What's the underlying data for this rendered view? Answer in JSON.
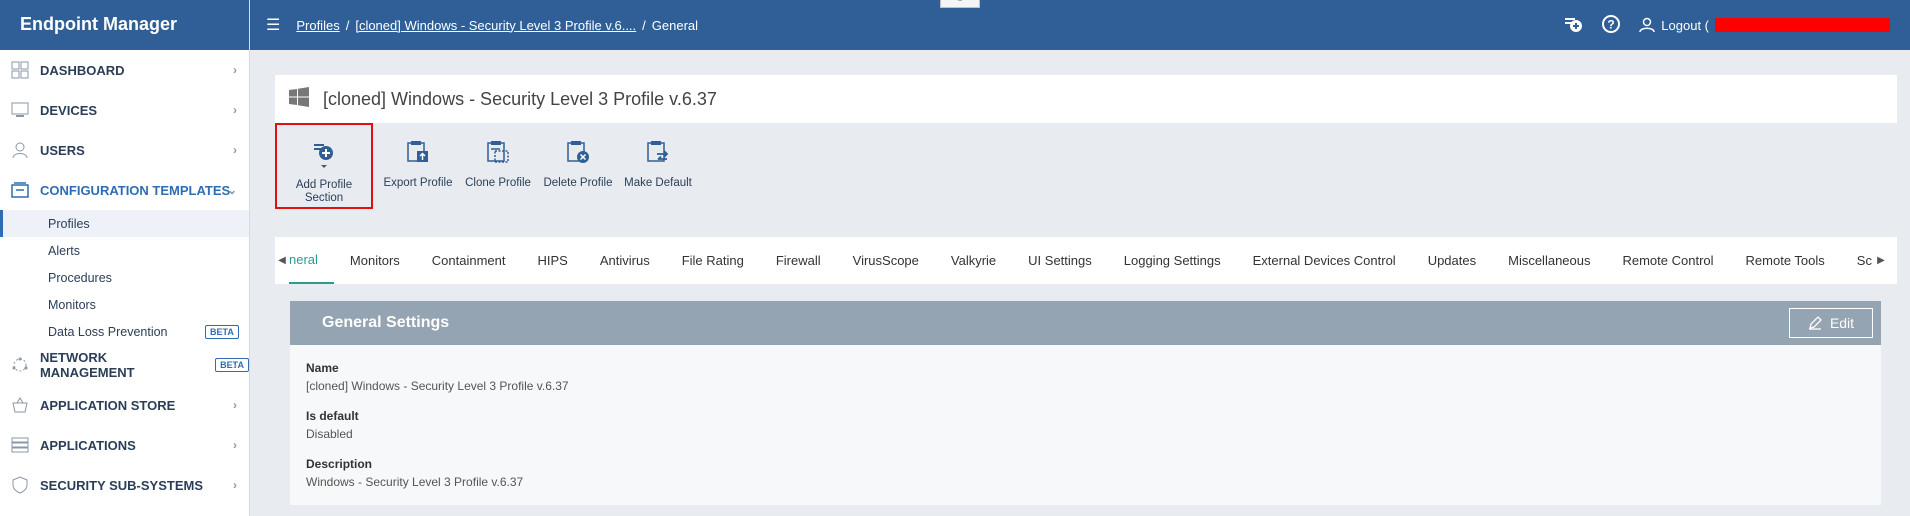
{
  "app": {
    "title": "Endpoint Manager"
  },
  "breadcrumb": {
    "items": [
      "Profiles",
      "[cloned] Windows - Security Level 3 Profile v.6....",
      "General"
    ]
  },
  "topbar": {
    "logout_label": "Logout ("
  },
  "sidebar": {
    "items": [
      {
        "label": "DASHBOARD",
        "icon": "dashboard-icon"
      },
      {
        "label": "DEVICES",
        "icon": "devices-icon"
      },
      {
        "label": "USERS",
        "icon": "user-icon"
      },
      {
        "label": "CONFIGURATION TEMPLATES",
        "icon": "templates-icon",
        "expanded": true
      },
      {
        "label": "NETWORK MANAGEMENT",
        "icon": "network-icon",
        "badge": "BETA"
      },
      {
        "label": "APPLICATION STORE",
        "icon": "store-icon"
      },
      {
        "label": "APPLICATIONS",
        "icon": "applications-icon"
      },
      {
        "label": "SECURITY SUB-SYSTEMS",
        "icon": "shield-icon"
      }
    ],
    "sub_items": [
      {
        "label": "Profiles",
        "selected": true
      },
      {
        "label": "Alerts"
      },
      {
        "label": "Procedures"
      },
      {
        "label": "Monitors"
      },
      {
        "label": "Data Loss Prevention",
        "badge": "BETA"
      }
    ]
  },
  "profile": {
    "title": "[cloned] Windows - Security Level 3 Profile v.6.37"
  },
  "toolbar": {
    "add_section": "Add Profile Section",
    "export": "Export Profile",
    "clone": "Clone Profile",
    "delete": "Delete Profile",
    "make_default": "Make Default"
  },
  "tabs": [
    "neral",
    "Monitors",
    "Containment",
    "HIPS",
    "Antivirus",
    "File Rating",
    "Firewall",
    "VirusScope",
    "Valkyrie",
    "UI Settings",
    "Logging Settings",
    "External Devices Control",
    "Updates",
    "Miscellaneous",
    "Remote Control",
    "Remote Tools",
    "Sc"
  ],
  "panel": {
    "title": "General Settings",
    "edit_label": "Edit",
    "fields": [
      {
        "label": "Name",
        "value": "[cloned] Windows - Security Level 3 Profile v.6.37"
      },
      {
        "label": "Is default",
        "value": "Disabled"
      },
      {
        "label": "Description",
        "value": "Windows - Security Level 3 Profile v.6.37"
      }
    ]
  },
  "colors": {
    "brand": "#2f5f96",
    "active_tab": "#2a9d8f",
    "panel_head": "#95a4b2",
    "highlight": "#e01010"
  }
}
